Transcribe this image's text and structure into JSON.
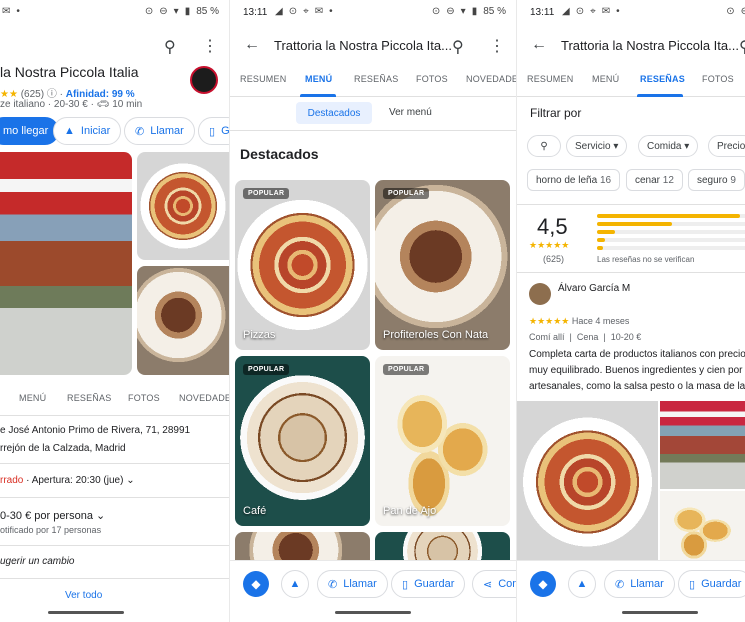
{
  "status": {
    "time": "13:11",
    "battery": "85 %"
  },
  "panel1": {
    "title": "la Nostra Piccola Italia",
    "rating_text": "(625)",
    "affinity": "Afinidad: 99 %",
    "info_line": "ze italiano · 20-30 € ·",
    "drive": "10 min",
    "buttons": {
      "directions": "mo llegar",
      "start": "Iniciar",
      "call": "Llamar",
      "save": "G"
    },
    "tabs": [
      "MENÚ",
      "RESEÑAS",
      "FOTOS",
      "NOVEDADES"
    ],
    "address1": "e José Antonio Primo de Rivera, 71, 28991",
    "address2": "rrejón de la Calzada, Madrid",
    "closed": "rrado",
    "hours": "· Apertura: 20:30 (jue)",
    "price": "0-30 € por persona",
    "price_note": "otificado por 17 personas",
    "suggest": "ugerir un cambio",
    "see_all": "Ver todo"
  },
  "panel2": {
    "title": "Trattoria la Nostra Piccola Ita...",
    "tabs": [
      "RESUMEN",
      "MENÚ",
      "RESEÑAS",
      "FOTOS",
      "NOVEDADES"
    ],
    "subtabs": [
      "Destacados",
      "Ver menú"
    ],
    "section": "Destacados",
    "badge": "POPULAR",
    "items": [
      "Pizzas",
      "Profiteroles Con Nata",
      "Café",
      "Pan de Ajo"
    ],
    "actions": {
      "call": "Llamar",
      "save": "Guardar",
      "share": "Con"
    }
  },
  "panel3": {
    "title": "Trattoria la Nostra Piccola Ita...",
    "tabs": [
      "RESUMEN",
      "MENÚ",
      "RESEÑAS",
      "FOTOS"
    ],
    "filter_title": "Filtrar por",
    "filters": [
      "Servicio",
      "Comida",
      "Precio"
    ],
    "chips": [
      {
        "label": "horno de leña",
        "count": "16"
      },
      {
        "label": "cenar",
        "count": "12"
      },
      {
        "label": "seguro",
        "count": "9"
      }
    ],
    "score": "4,5",
    "count": "(625)",
    "bars": [
      0.95,
      0.5,
      0.12,
      0.05,
      0.04
    ],
    "unverified": "Las reseñas no se verifican",
    "reviewer": "Álvaro García M",
    "review_when": "Hace 4 meses",
    "review_meta1": "Comí allí",
    "review_meta2": "Cena",
    "review_meta3": "10-20 €",
    "review_text1": "Completa carta de productos italianos con precio",
    "review_text2": "muy equilibrado. Buenos ingredientes y cien por c",
    "review_text3": "artesanales, como la salsa pesto o la masa de las",
    "actions": {
      "call": "Llamar",
      "save": "Guardar"
    }
  },
  "colors": {
    "accent": "#1a73e8",
    "star": "#f4b400",
    "closed": "#d93025"
  }
}
